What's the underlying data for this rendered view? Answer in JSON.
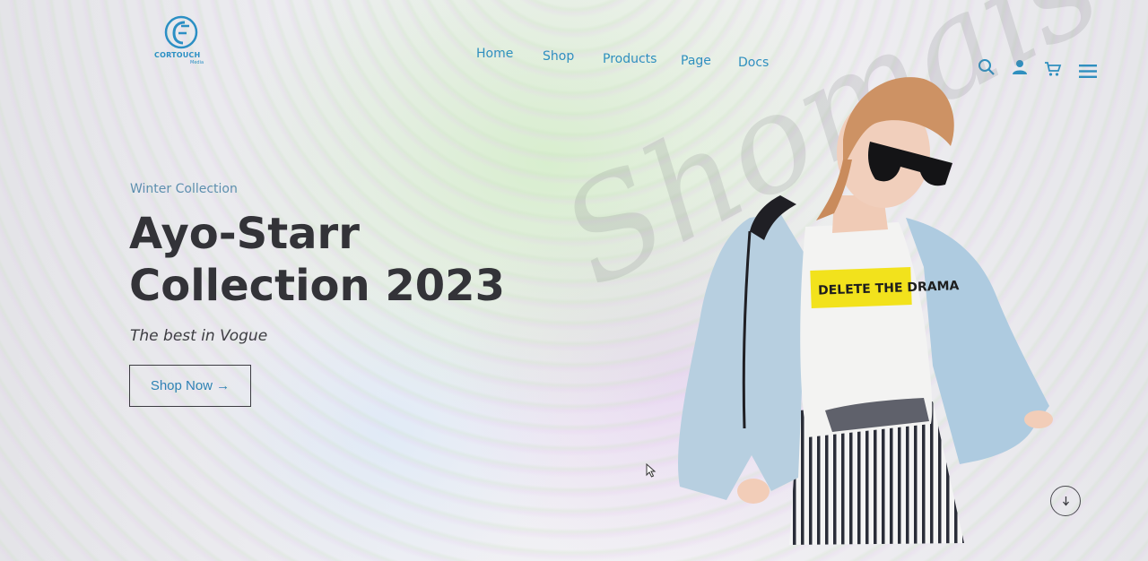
{
  "brand": {
    "name": "CORTOUCH",
    "sub": "Media"
  },
  "nav": {
    "items": [
      "Home",
      "Shop",
      "Products",
      "Page",
      "Docs"
    ]
  },
  "header_icons": [
    "search-icon",
    "user-icon",
    "cart-icon",
    "menu-icon"
  ],
  "hero": {
    "eyebrow": "Winter Collection",
    "title_line1": "Ayo-Starr",
    "title_line2": "Collection 2023",
    "tagline": "The best in Vogue",
    "cta": "Shop Now →",
    "shirt_text": "DELETE THE DRAMA",
    "watermark": "Shomais"
  },
  "colors": {
    "accent": "#2f8fbf",
    "heading": "#333338",
    "shirt_band": "#f2e21c"
  }
}
